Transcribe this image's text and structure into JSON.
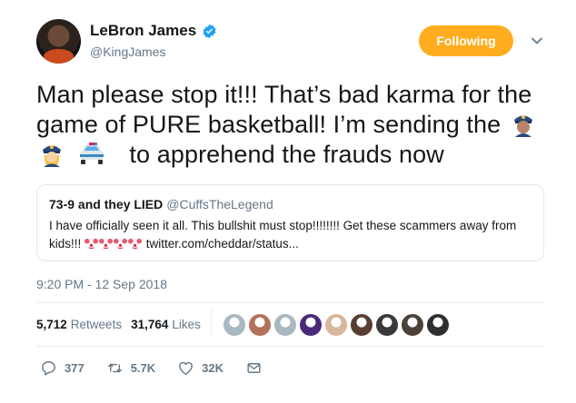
{
  "author": {
    "display_name": "LeBron James",
    "handle": "@KingJames",
    "verified": true
  },
  "follow_button": {
    "label": "Following",
    "color": "#ffad1f"
  },
  "tweet": {
    "line1": "Man please stop it!!! That’s bad karma for the",
    "line2_text": "game of PURE basketball! I’m sending the",
    "line3_text": "to apprehend the frauds now",
    "emojis": [
      "police-officer-man-emoji",
      "police-officer-woman-emoji",
      "police-car-emoji"
    ]
  },
  "quote": {
    "name": "73-9 and they LIED",
    "handle": "@CuffsTheLegend",
    "text": "I have officially seen it all. This bullshit must stop!!!!!!!! Get these scammers away from",
    "text2_prefix": "kids!!!",
    "link": "twitter.com/cheddar/status...",
    "emojis": [
      "clown-emoji",
      "clown-emoji",
      "clown-emoji",
      "clown-emoji"
    ]
  },
  "timestamp": "9:20 PM - 12 Sep 2018",
  "stats": {
    "retweets_count": "5,712",
    "retweets_label": "Retweets",
    "likes_count": "31,764",
    "likes_label": "Likes"
  },
  "likers": [
    "#aab8c2",
    "#b2735a",
    "#aab8c2",
    "#4b2a7a",
    "#d9b79c",
    "#5a3e33",
    "#3a3a3a",
    "#4a4238",
    "#2f2f2f"
  ],
  "actions": {
    "replies": "377",
    "retweets": "5.7K",
    "likes": "32K"
  },
  "colors": {
    "text": "#14171a",
    "secondary": "#657786",
    "verified": "#1da1f2",
    "border": "#e1e8ed"
  }
}
